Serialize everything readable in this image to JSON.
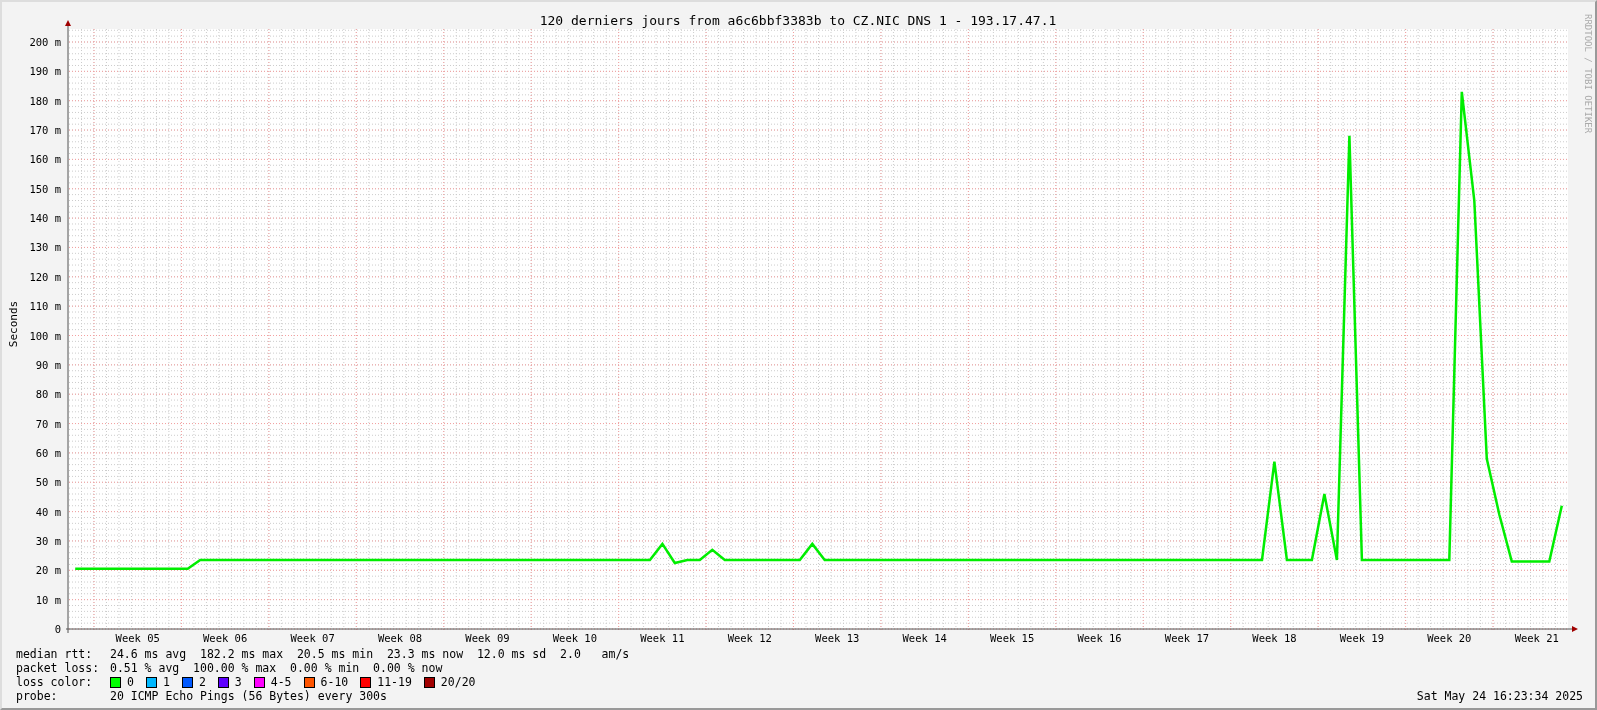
{
  "side_note": "RRDTOOL / TOBI OETIKER",
  "chart_data": {
    "type": "line",
    "title": "120 derniers jours from a6c6bbf3383b to CZ.NIC DNS 1 - 193.17.47.1",
    "ylabel": "Seconds",
    "ylim": [
      0,
      200
    ],
    "grid": true,
    "yticks": [
      {
        "value": 0,
        "label": "0"
      },
      {
        "value": 10,
        "label": "10 m"
      },
      {
        "value": 20,
        "label": "20 m"
      },
      {
        "value": 30,
        "label": "30 m"
      },
      {
        "value": 40,
        "label": "40 m"
      },
      {
        "value": 50,
        "label": "50 m"
      },
      {
        "value": 60,
        "label": "60 m"
      },
      {
        "value": 70,
        "label": "70 m"
      },
      {
        "value": 80,
        "label": "80 m"
      },
      {
        "value": 90,
        "label": "90 m"
      },
      {
        "value": 100,
        "label": "100 m"
      },
      {
        "value": 110,
        "label": "110 m"
      },
      {
        "value": 120,
        "label": "120 m"
      },
      {
        "value": 130,
        "label": "130 m"
      },
      {
        "value": 140,
        "label": "140 m"
      },
      {
        "value": 150,
        "label": "150 m"
      },
      {
        "value": 160,
        "label": "160 m"
      },
      {
        "value": 170,
        "label": "170 m"
      },
      {
        "value": 180,
        "label": "180 m"
      },
      {
        "value": 190,
        "label": "190 m"
      },
      {
        "value": 200,
        "label": "200 m"
      }
    ],
    "categories": [
      null,
      null,
      null,
      null,
      null,
      "Week 05",
      null,
      null,
      null,
      null,
      null,
      null,
      "Week 06",
      null,
      null,
      null,
      null,
      null,
      null,
      "Week 07",
      null,
      null,
      null,
      null,
      null,
      null,
      "Week 08",
      null,
      null,
      null,
      null,
      null,
      null,
      "Week 09",
      null,
      null,
      null,
      null,
      null,
      null,
      "Week 10",
      null,
      null,
      null,
      null,
      null,
      null,
      "Week 11",
      null,
      null,
      null,
      null,
      null,
      null,
      "Week 12",
      null,
      null,
      null,
      null,
      null,
      null,
      "Week 13",
      null,
      null,
      null,
      null,
      null,
      null,
      "Week 14",
      null,
      null,
      null,
      null,
      null,
      null,
      "Week 15",
      null,
      null,
      null,
      null,
      null,
      null,
      "Week 16",
      null,
      null,
      null,
      null,
      null,
      null,
      "Week 17",
      null,
      null,
      null,
      null,
      null,
      null,
      "Week 18",
      null,
      null,
      null,
      null,
      null,
      null,
      "Week 19",
      null,
      null,
      null,
      null,
      null,
      null,
      "Week 20",
      null,
      null,
      null,
      null,
      null,
      null,
      "Week 21",
      null,
      null
    ],
    "series": [
      {
        "color": "#00ee00",
        "values": [
          20.5,
          20.5,
          20.5,
          20.5,
          20.5,
          20.5,
          20.5,
          20.5,
          20.5,
          20.5,
          23.5,
          23.5,
          23.5,
          23.5,
          23.5,
          23.5,
          23.5,
          23.5,
          23.5,
          23.5,
          23.5,
          23.5,
          23.5,
          23.5,
          23.5,
          23.5,
          23.5,
          23.5,
          23.5,
          23.5,
          23.5,
          23.5,
          23.5,
          23.5,
          23.5,
          23.5,
          23.5,
          23.5,
          23.5,
          23.5,
          23.5,
          23.5,
          23.5,
          23.5,
          23.5,
          23.5,
          23.5,
          29,
          22.5,
          23.5,
          23.5,
          27,
          23.5,
          23.5,
          23.5,
          23.5,
          23.5,
          23.5,
          23.5,
          29,
          23.5,
          23.5,
          23.5,
          23.5,
          23.5,
          23.5,
          23.5,
          23.5,
          23.5,
          23.5,
          23.5,
          23.5,
          23.5,
          23.5,
          23.5,
          23.5,
          23.5,
          23.5,
          23.5,
          23.5,
          23.5,
          23.5,
          23.5,
          23.5,
          23.5,
          23.5,
          23.5,
          23.5,
          23.5,
          23.5,
          23.5,
          23.5,
          23.5,
          23.5,
          23.5,
          23.5,
          57,
          23.5,
          23.5,
          23.5,
          46,
          23.5,
          168,
          23.5,
          23.5,
          23.5,
          23.5,
          23.5,
          23.5,
          23.5,
          23.5,
          183,
          146,
          58,
          39,
          23,
          23,
          23,
          23,
          42
        ]
      }
    ]
  },
  "legend": {
    "median_rtt": {
      "label": "median rtt:",
      "value": "24.6 ms avg  182.2 ms max  20.5 ms min  23.3 ms now  12.0 ms sd  2.0   am/s"
    },
    "packet_loss": {
      "label": "packet loss:",
      "value": "0.51 % avg  100.00 % max  0.00 % min  0.00 % now"
    },
    "loss_color": {
      "label": "loss color:",
      "items": [
        {
          "label": "0",
          "color": "#00ff00"
        },
        {
          "label": "1",
          "color": "#00b8ff"
        },
        {
          "label": "2",
          "color": "#0059ff"
        },
        {
          "label": "3",
          "color": "#5e00ff"
        },
        {
          "label": "4-5",
          "color": "#ff00ff"
        },
        {
          "label": "6-10",
          "color": "#ff5500"
        },
        {
          "label": "11-19",
          "color": "#ff0000"
        },
        {
          "label": "20/20",
          "color": "#a10000"
        }
      ]
    },
    "probe": {
      "label": "probe:",
      "value": "20 ICMP Echo Pings (56 Bytes) every 300s"
    }
  },
  "timestamp": "Sat May 24 16:23:34 2025"
}
